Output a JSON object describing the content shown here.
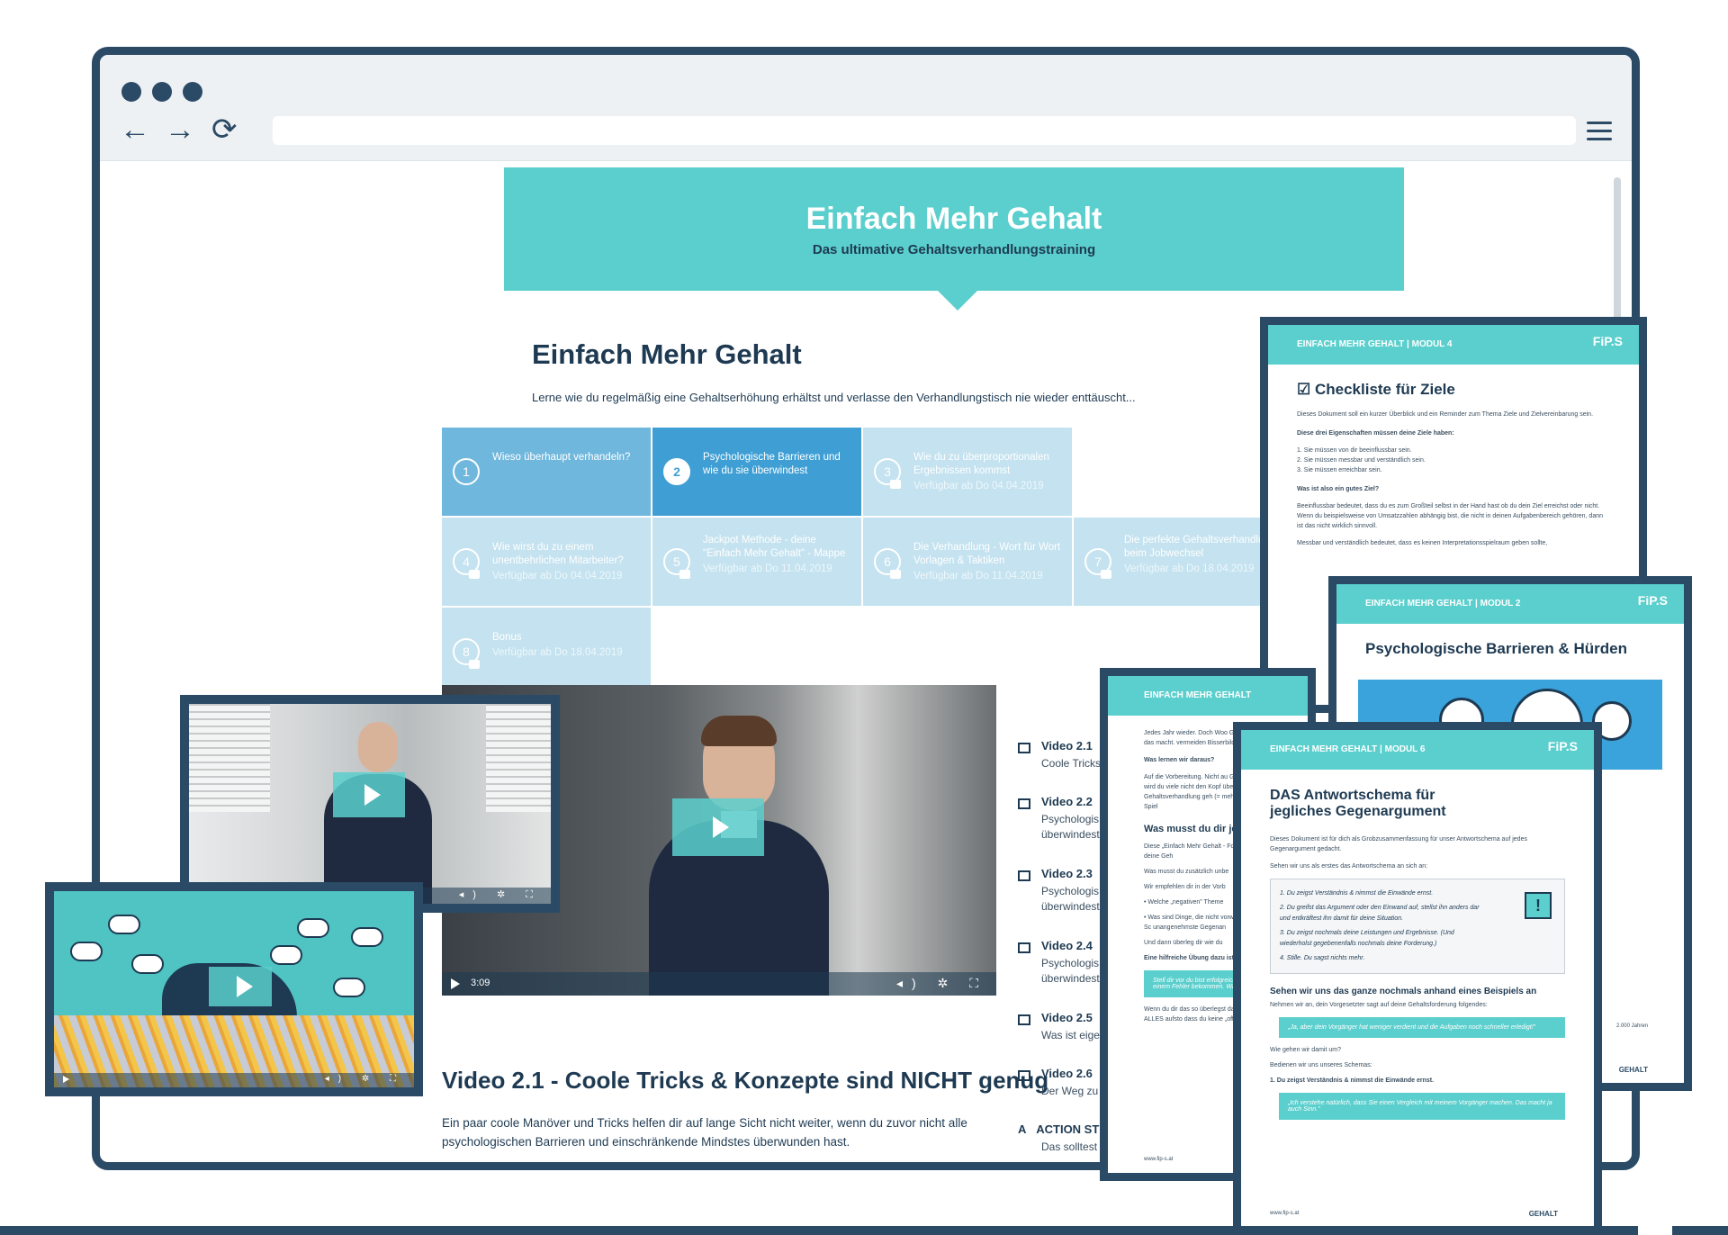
{
  "hero": {
    "title": "Einfach Mehr Gehalt",
    "subtitle": "Das ultimative Gehaltsverhandlungstraining"
  },
  "course": {
    "title": "Einfach Mehr Gehalt",
    "intro": "Lerne wie du regelmäßig eine Gehaltserhöhung erhältst und verlasse den Verhandlungstisch nie wieder enttäuscht..."
  },
  "modules": [
    {
      "num": "1",
      "title": "Wieso überhaupt verhandeln?",
      "available": ""
    },
    {
      "num": "2",
      "title": "Psychologische Barrieren und wie du sie überwindest",
      "available": ""
    },
    {
      "num": "3",
      "title": "Wie du zu überproportionalen Ergebnissen kommst",
      "available": "Verfügbar ab Do 04.04.2019"
    },
    {
      "num": "4",
      "title": "Wie wirst du zu einem unentbehrlichen Mitarbeiter?",
      "available": "Verfügbar ab Do 04.04.2019"
    },
    {
      "num": "5",
      "title": "Jackpot Methode - deine \"Einfach Mehr Gehalt\" - Mappe",
      "available": "Verfügbar ab Do 11.04.2019"
    },
    {
      "num": "6",
      "title": "Die Verhandlung - Wort für Wort Vorlagen & Taktiken",
      "available": "Verfügbar ab Do 11.04.2019"
    },
    {
      "num": "7",
      "title": "Die perfekte Gehaltsverhandlung beim Jobwechsel",
      "available": "Verfügbar ab Do 18.04.2019"
    },
    {
      "num": "8",
      "title": "Bonus",
      "available": "Verfügbar ab Do 18.04.2019"
    }
  ],
  "player": {
    "time": "3:09"
  },
  "video": {
    "title": "Video 2.1 - Coole Tricks & Konzepte sind NICHT genug",
    "description": "Ein paar coole Manöver und Tricks helfen dir auf lange Sicht nicht weiter, wenn du zuvor nicht alle psychologischen Barrieren und einschränkende Mindstes überwunden hast."
  },
  "playlist": [
    {
      "title": "Video 2.1",
      "sub": "Coole Tricks"
    },
    {
      "title": "Video 2.2",
      "sub": "Psychologis\nüberwindest"
    },
    {
      "title": "Video 2.3",
      "sub": "Psychologis\nüberwindest"
    },
    {
      "title": "Video 2.4",
      "sub": "Psychologis\nüberwindest"
    },
    {
      "title": "Video 2.5",
      "sub": "Was ist eige"
    },
    {
      "title": "Video 2.6",
      "sub": "Der Weg zu"
    },
    {
      "title": "ACTION ST",
      "sub": "Das solltest"
    }
  ],
  "docs": {
    "modul4": {
      "header": "EINFACH MEHR GEHALT | MODUL 4",
      "logo": "FiP.S",
      "title": "Checkliste für Ziele",
      "intro": "Dieses Dokument soll ein kurzer Überblick und ein Reminder zum Thema Ziele und Zielvereinbarung sein.",
      "heading1": "Diese drei Eigenschaften müssen deine Ziele haben:",
      "items": [
        "1.  Sie müssen von dir beeinflussbar sein.",
        "2.  Sie müssen messbar und verständlich sein.",
        "3.  Sie müssen erreichbar sein."
      ],
      "heading2": "Was ist also ein gutes Ziel?",
      "para1": "Beeinflussbar bedeutet, dass du es zum Großteil selbst in der Hand hast ob du dein Ziel erreichst oder nicht. Wenn du beispielsweise von Umsatzzahlen abhängig bist, die nicht in deinen Aufgabenbereich gehören, dann ist das nicht wirklich sinnvoll.",
      "para2": "Messbar und verständlich bedeutet, dass es keinen Interpretationsspielraum geben sollte,"
    },
    "modul2": {
      "header": "EINFACH MEHR GEHALT | MODUL 2",
      "logo": "FiP.S",
      "title": "Psychologische Barrieren & Hürden",
      "footer": "2.000 Jahren",
      "brand": "GEHALT"
    },
    "mid": {
      "header": "EINFACH MEHR GEHALT",
      "p1": "Jedes Jahr wieder. Doch Woo Grund, warum er das macht. vermeiden Bisserbildung und",
      "h1": "Was lernen wir daraus?",
      "p2": "Auf die Vorbereitung. Nicht au Gehaltsgespräch wird du viele nicht den Kopf über das Einfach einer Gehaltsverhandlung geh (= mehr Gehalt oder ein Spiel",
      "h2": "Was musst du dir jet",
      "p3": "Diese „Einfach Mehr Gehalt - Forderungen und deine Geh",
      "p4": "Was musst du zusätzlich unbe",
      "p5": "Wir empfehlen dir in der Vorb",
      "b1": "•  Welche „negativen\" Theme",
      "b2": "•  Was sind Dinge, die nicht vorwerfen? Was ist das Sc unangenehmste Gegenan",
      "p6": "Und dann überleg dir wie du",
      "h3": "Eine hilfreiche Übung dazu ist",
      "quote": "Stell dir vor du bist erfolgreich sein, erkläre einem Fehler bekommen. Was genau",
      "p7": "Wenn du dir das so überlegst darum, dass du ALLES aufsto dass du keine „offensichtliche",
      "footer": "www.fip-s.at"
    },
    "modul6": {
      "header": "EINFACH MEHR GEHALT | MODUL 6",
      "logo": "FiP.S",
      "title": "DAS Antwortschema für jegliches Gegenargument",
      "intro": "Dieses Dokument ist für dich als Grobzusammenfassung für unser Antwortschema auf jedes Gegenargument gedacht.",
      "intro2": "Sehen wir uns als erstes das Antwortschema an sich an:",
      "steps": [
        "1.  Du zeigst Verständnis & nimmst die Einwände ernst.",
        "2.  Du greifst das Argument oder den Einwand auf, stellst ihn anders dar und entkräftest ihn damit für deine Situation.",
        "3.  Du zeigst nochmals deine Leistungen und Ergebnisse. (Und wiederholst gegebenenfalls nochmals deine Forderung.)",
        "4.  Stille. Du sagst nichts mehr."
      ],
      "subtitle": "Sehen wir uns das ganze nochmals anhand eines Beispiels an",
      "p1": "Nehmen wir an, dein Vorgesetzter sagt auf deine Gehaltsforderung folgendes:",
      "quote1": "„Ja, aber dein Vorgänger hat weniger verdient und die Aufgaben noch schneller erledigt!\"",
      "p2": "Wie gehen wir damit um?",
      "p3": "Bedienen wir uns unseres Schemas:",
      "p4": "1. Du zeigst Verständnis & nimmst die Einwände ernst.",
      "quote2": "„Ich verstehe natürlich, dass Sie einen Vergleich mit meinem Vorgänger machen. Das macht ja auch Sinn.\"",
      "footer": "www.fip-s.at",
      "brand": "GEHALT"
    }
  },
  "colors": {
    "frame": "#2b4a66",
    "accent": "#5bcfcd",
    "module_active": "#3f9fd4",
    "module_locked": "#c4e2ef"
  }
}
